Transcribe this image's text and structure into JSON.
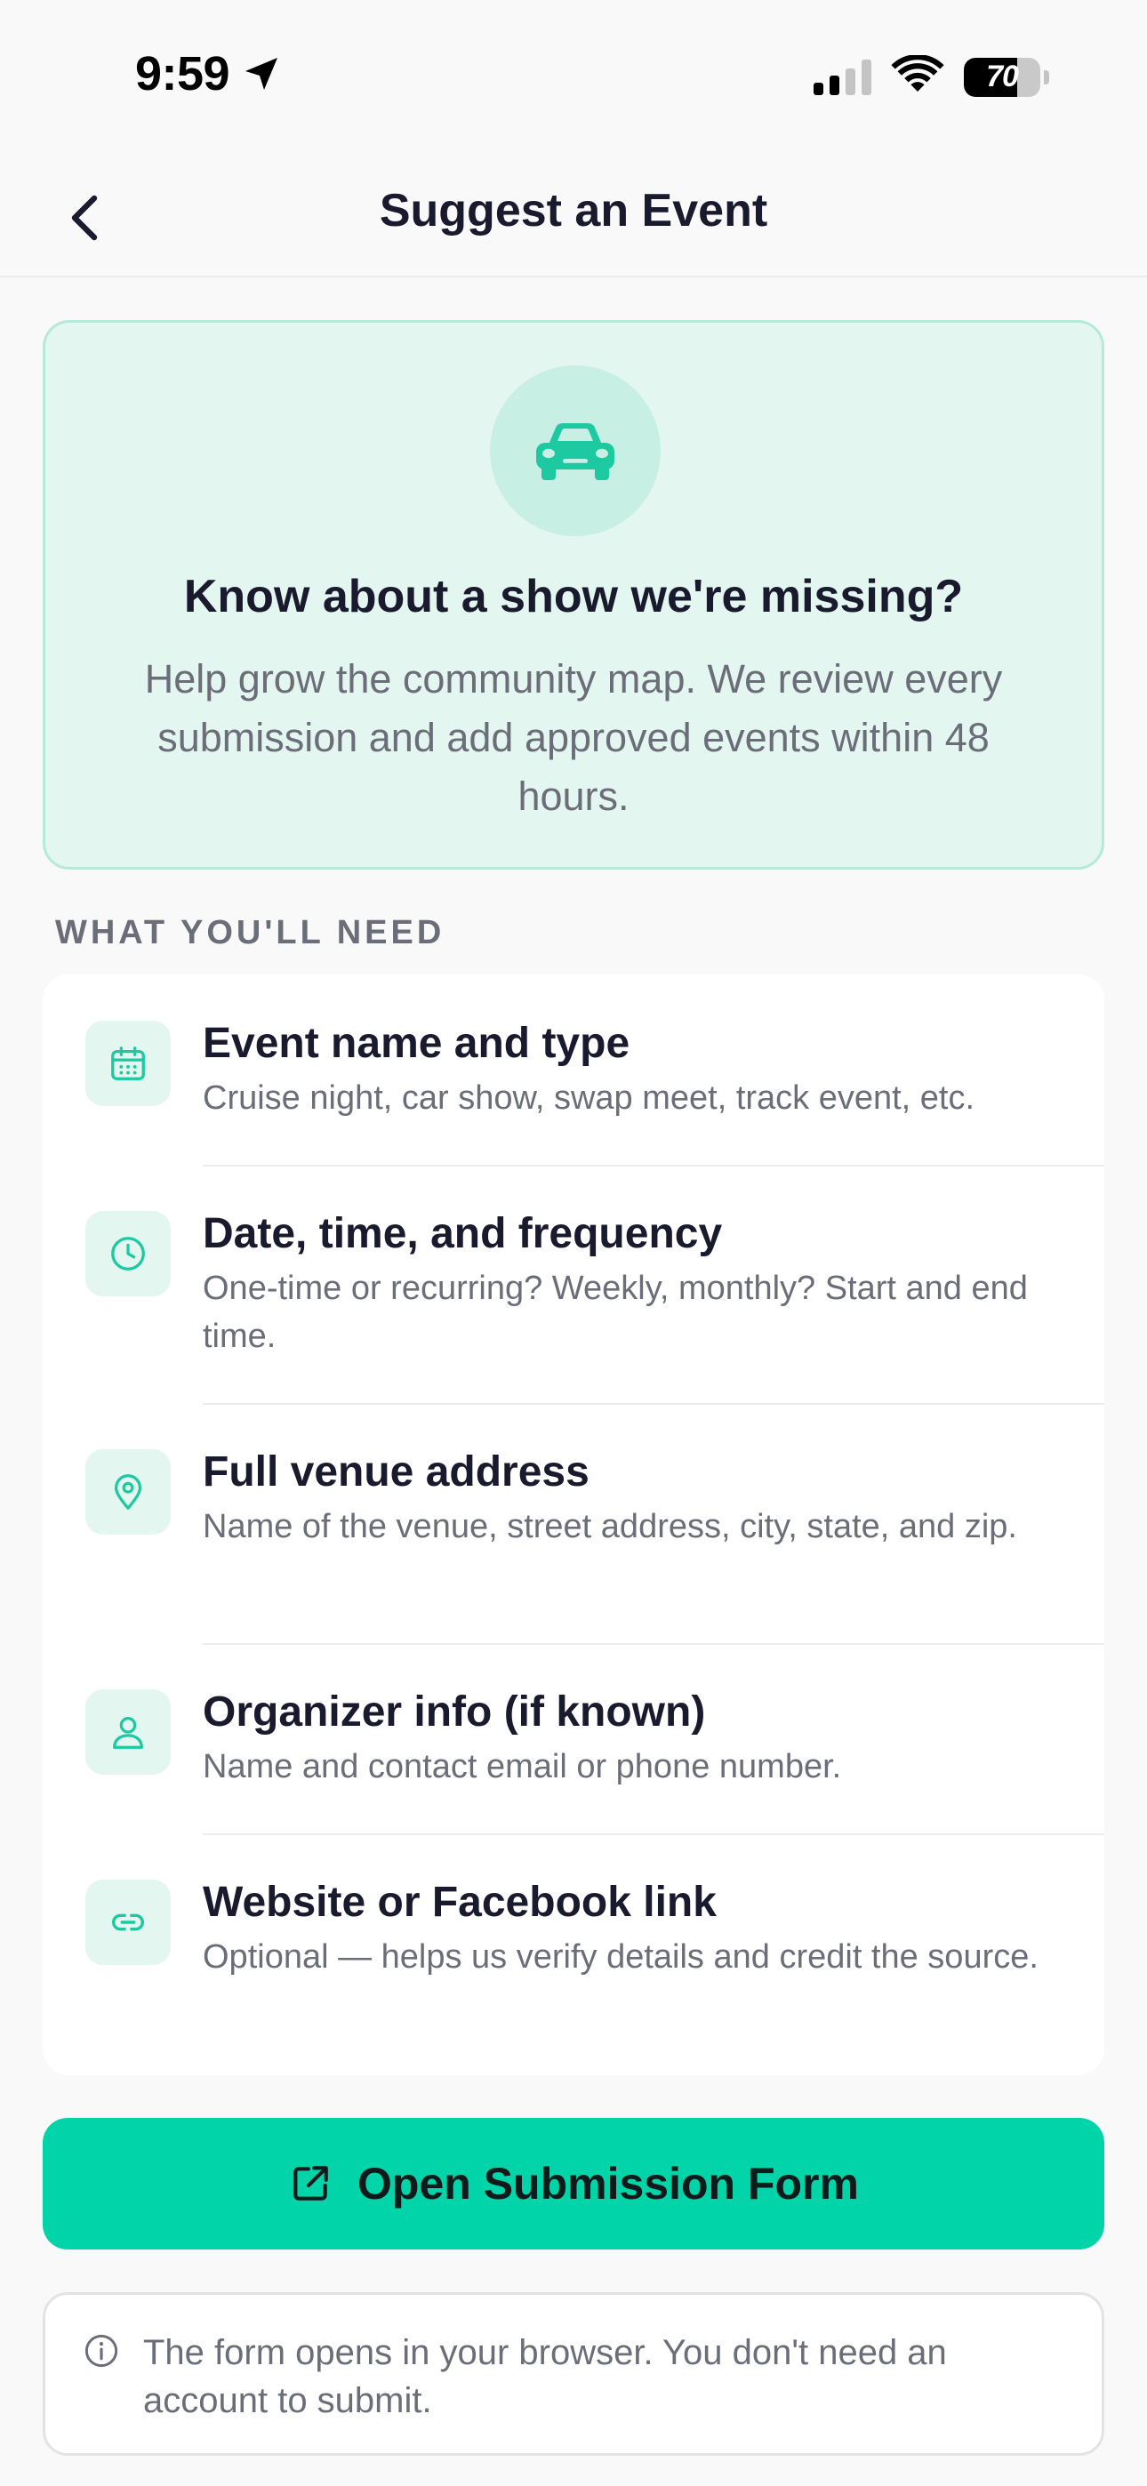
{
  "status_bar": {
    "time": "9:59",
    "battery": "70",
    "location_icon": "location-arrow-icon",
    "wifi_icon": "wifi-icon",
    "signal_icon": "cellular-signal-icon",
    "signal_bars_active": 2
  },
  "nav": {
    "title": "Suggest an Event",
    "back_icon": "chevron-left-icon"
  },
  "hero": {
    "icon": "car-icon",
    "title": "Know about a show we're missing?",
    "description": "Help grow the community map. We review every submission and add approved events within 48 hours."
  },
  "requirements": {
    "header": "WHAT YOU'LL NEED",
    "items": [
      {
        "icon": "calendar-icon",
        "title": "Event name and type",
        "description": "Cruise night, car show, swap meet, track event, etc."
      },
      {
        "icon": "clock-icon",
        "title": "Date, time, and frequency",
        "description": "One-time or recurring? Weekly, monthly? Start and end time."
      },
      {
        "icon": "location-pin-icon",
        "title": "Full venue address",
        "description": "Name of the venue, street address, city, state, and zip."
      },
      {
        "icon": "person-icon",
        "title": "Organizer info (if known)",
        "description": "Name and contact email or phone number."
      },
      {
        "icon": "link-icon",
        "title": "Website or Facebook link",
        "description": "Optional — helps us verify details and credit the source."
      }
    ]
  },
  "cta": {
    "label": "Open Submission Form",
    "icon": "external-link-icon"
  },
  "note": {
    "icon": "info-icon",
    "text": "The form opens in your browser. You don't need an account to submit."
  },
  "colors": {
    "accent": "#00d4a8",
    "accent_tint": "#e4f6f0",
    "icon_teal": "#1cc9a0",
    "text_primary": "#1a1a2e",
    "text_secondary": "#6b6e78",
    "background": "#f9f9f9"
  }
}
